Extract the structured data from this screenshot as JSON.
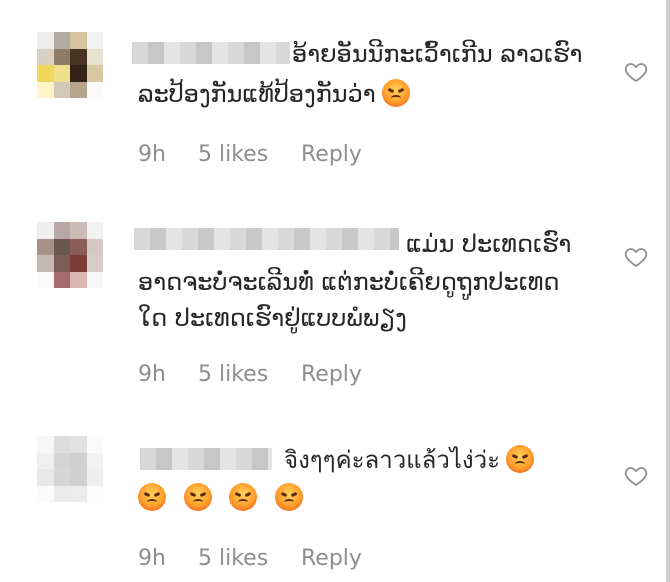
{
  "comments": [
    {
      "lines": [
        "ອ້າຍອັນນີກະເວົ້າເກີນ ລາວເຮົາ",
        "ລະປ້ອງກັນແທ້ປ້ອງກັນວ່າ"
      ],
      "emoji_names": [
        "angry-face-emoji"
      ],
      "time": "9h",
      "likes": "5 likes",
      "reply": "Reply"
    },
    {
      "lines": [
        "ແມ່ນ ປະເທດເຮົາ",
        "ອາດຈະບໍ່ຈະເລີນທໍ່ ແຕ່ກະບໍ່ເຄີຍດູຖູກປະເທດ",
        "ໃດ ປະເທດເຮົາຢູ່ແບບພໍພຽງ"
      ],
      "emoji_names": [],
      "time": "9h",
      "likes": "5 likes",
      "reply": "Reply"
    },
    {
      "lines": [
        "จิงๆๆค่ะลาวแล้วไง่ว่ะ",
        ""
      ],
      "emoji_names": [
        "angry-face-emoji",
        "angry-face-emoji",
        "angry-face-emoji",
        "angry-face-emoji",
        "angry-face-emoji"
      ],
      "time": "9h",
      "likes": "5 likes",
      "reply": "Reply"
    }
  ],
  "icons": {
    "like": "heart-outline-icon",
    "reaction": "angry-face-emoji"
  },
  "colors": {
    "text": "#262626",
    "meta": "#8e8e8e",
    "background": "#ffffff"
  }
}
